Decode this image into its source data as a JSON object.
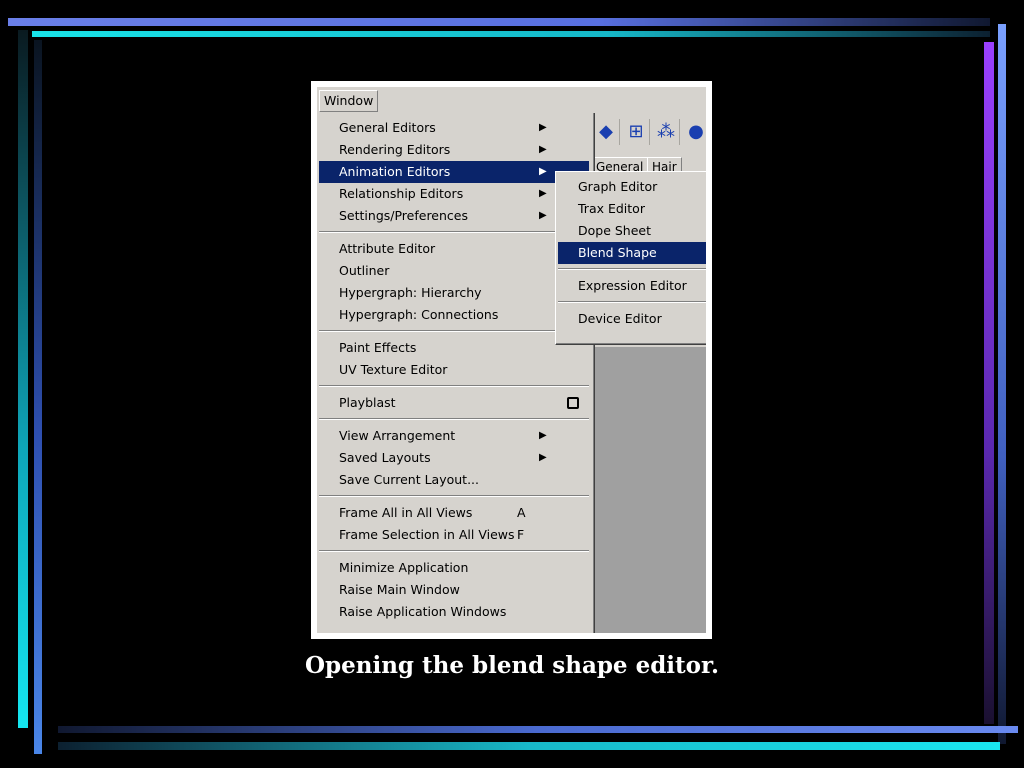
{
  "menubar": {
    "window_label": "Window"
  },
  "toolbar_icons": [
    "cube-icon",
    "lattice-icon",
    "particle-icon",
    "sphere-icon"
  ],
  "tabs": [
    "General",
    "Hair"
  ],
  "main_menu": {
    "items": [
      {
        "label": "General Editors",
        "submenu": true
      },
      {
        "label": "Rendering Editors",
        "submenu": true
      },
      {
        "label": "Animation Editors",
        "submenu": true,
        "highlighted": true
      },
      {
        "label": "Relationship Editors",
        "submenu": true
      },
      {
        "label": "Settings/Preferences",
        "submenu": true
      },
      {
        "label": "Attribute Editor"
      },
      {
        "label": "Outliner"
      },
      {
        "label": "Hypergraph: Hierarchy"
      },
      {
        "label": "Hypergraph: Connections"
      },
      {
        "label": "Paint Effects"
      },
      {
        "label": "UV Texture Editor"
      },
      {
        "label": "Playblast",
        "option_box": true
      },
      {
        "label": "View Arrangement",
        "submenu": true
      },
      {
        "label": "Saved Layouts",
        "submenu": true
      },
      {
        "label": "Save Current Layout..."
      },
      {
        "label": "Frame All in All Views",
        "shortcut": "A"
      },
      {
        "label": "Frame Selection in All Views",
        "shortcut": "F"
      },
      {
        "label": "Minimize Application"
      },
      {
        "label": "Raise Main Window"
      },
      {
        "label": "Raise Application Windows"
      }
    ]
  },
  "submenu": {
    "items": [
      {
        "label": "Graph Editor"
      },
      {
        "label": "Trax Editor"
      },
      {
        "label": "Dope Sheet"
      },
      {
        "label": "Blend Shape",
        "highlighted": true
      },
      {
        "label": "Expression Editor"
      },
      {
        "label": "Device Editor"
      }
    ]
  },
  "caption": "Opening the blend shape editor.",
  "colors": {
    "highlight": "#0a246a",
    "menu_bg": "#d6d3ce",
    "accent_cyan": "#19e3e8",
    "accent_blue": "#6a7fe8",
    "accent_purple": "#9a40ff"
  }
}
